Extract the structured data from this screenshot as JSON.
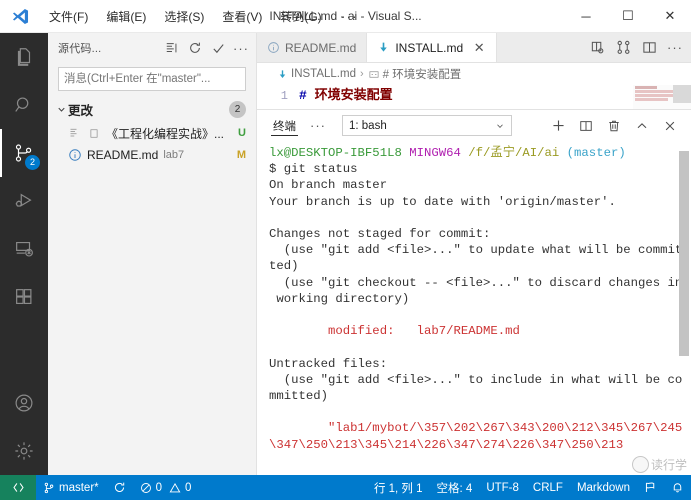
{
  "titlebar": {
    "logo_icon": "vscode-logo-icon",
    "menus": [
      {
        "label": "文件(F)",
        "name": "menu-file"
      },
      {
        "label": "编辑(E)",
        "name": "menu-edit"
      },
      {
        "label": "选择(S)",
        "name": "menu-selection"
      },
      {
        "label": "查看(V)",
        "name": "menu-view"
      },
      {
        "label": "转到(G)",
        "name": "menu-go"
      }
    ],
    "more_label": "···",
    "window_title": "INSTALL.md - ai - Visual S...",
    "minimize_label": "─",
    "maximize_label": "☐",
    "close_label": "✕"
  },
  "activitybar": {
    "items": [
      {
        "name": "explorer",
        "icon": "files-icon",
        "active": false,
        "badge": ""
      },
      {
        "name": "search",
        "icon": "search-icon",
        "active": false,
        "badge": ""
      },
      {
        "name": "source-control",
        "icon": "source-control-icon",
        "active": true,
        "badge": "2"
      },
      {
        "name": "run-and-debug",
        "icon": "debug-icon",
        "active": false,
        "badge": ""
      },
      {
        "name": "remote-explorer",
        "icon": "remote-icon",
        "active": false,
        "badge": ""
      },
      {
        "name": "extensions",
        "icon": "extensions-icon",
        "active": false,
        "badge": ""
      }
    ],
    "bottom_items": [
      {
        "name": "accounts",
        "icon": "account-icon"
      },
      {
        "name": "settings",
        "icon": "gear-icon"
      }
    ]
  },
  "sidebar": {
    "title": "源代码...",
    "actions": [
      {
        "name": "view-as-tree",
        "icon": "list-icon",
        "label": "☰"
      },
      {
        "name": "refresh",
        "icon": "refresh-icon",
        "label": "↻"
      },
      {
        "name": "commit",
        "icon": "check-icon",
        "label": "✓"
      },
      {
        "name": "more-actions",
        "icon": "ellipsis-icon",
        "label": "···"
      }
    ],
    "commit_placeholder": "消息(Ctrl+Enter 在\"master\"...",
    "commit_value": "",
    "group": {
      "label": "更改",
      "count": "2",
      "expanded": true
    },
    "files": [
      {
        "name": "《工程化编程实战》...",
        "path": "",
        "flag": "U",
        "flag_class": "flag-U",
        "icon": "file-lines-icon"
      },
      {
        "name": "README.md",
        "path": "lab7",
        "flag": "M",
        "flag_class": "flag-M",
        "icon": "info-icon"
      }
    ]
  },
  "editor": {
    "tabs": [
      {
        "label": "README.md",
        "icon": "info-icon",
        "active": false,
        "close": ""
      },
      {
        "label": "INSTALL.md",
        "icon": "markdown-down-icon",
        "active": true,
        "close": "✕"
      }
    ],
    "actions": [
      {
        "name": "split-editor-right",
        "icon": "open-changes-icon"
      },
      {
        "name": "compare-changes",
        "icon": "compare-icon"
      },
      {
        "name": "split-editor",
        "icon": "split-editor-icon"
      },
      {
        "name": "more-actions",
        "icon": "ellipsis-icon",
        "label": "···"
      }
    ],
    "breadcrumb": {
      "file": "INSTALL.md",
      "separator": "›",
      "symbol": "# 环境安装配置"
    },
    "lines": [
      {
        "number": "1",
        "hash": "#",
        "text": " 环境安装配置"
      }
    ]
  },
  "panel": {
    "tab_label": "终端",
    "more_label": "···",
    "terminal_select": "1: bash",
    "actions": [
      {
        "name": "new-terminal",
        "icon": "plus-icon",
        "label": "+"
      },
      {
        "name": "split-terminal",
        "icon": "split-icon",
        "label": ""
      },
      {
        "name": "kill-terminal",
        "icon": "trash-icon",
        "label": ""
      },
      {
        "name": "maximize-panel",
        "icon": "chevron-up-icon",
        "label": "⌃"
      },
      {
        "name": "close-panel",
        "icon": "close-icon",
        "label": "✕"
      }
    ],
    "terminal_lines": [
      {
        "segments": [
          {
            "text": "lx@DESKTOP-IBF51L8",
            "cls": "t-green"
          },
          {
            "text": " ",
            "cls": ""
          },
          {
            "text": "MINGW64",
            "cls": "t-purple"
          },
          {
            "text": " ",
            "cls": ""
          },
          {
            "text": "/f/孟宁/AI/ai",
            "cls": "t-olive"
          },
          {
            "text": " ",
            "cls": ""
          },
          {
            "text": "(master)",
            "cls": "t-cyan"
          }
        ]
      },
      {
        "segments": [
          {
            "text": "$ git status",
            "cls": ""
          }
        ]
      },
      {
        "segments": [
          {
            "text": "On branch master",
            "cls": ""
          }
        ]
      },
      {
        "segments": [
          {
            "text": "Your branch is up to date with 'origin/master'.",
            "cls": ""
          }
        ]
      },
      {
        "segments": [
          {
            "text": "",
            "cls": ""
          }
        ]
      },
      {
        "segments": [
          {
            "text": "Changes not staged for commit:",
            "cls": ""
          }
        ]
      },
      {
        "segments": [
          {
            "text": "  (use \"git add <file>...\" to update what will be commit",
            "cls": ""
          }
        ]
      },
      {
        "segments": [
          {
            "text": "ted)",
            "cls": ""
          }
        ]
      },
      {
        "segments": [
          {
            "text": "  (use \"git checkout -- <file>...\" to discard changes in",
            "cls": ""
          }
        ]
      },
      {
        "segments": [
          {
            "text": " working directory)",
            "cls": ""
          }
        ]
      },
      {
        "segments": [
          {
            "text": "",
            "cls": ""
          }
        ]
      },
      {
        "segments": [
          {
            "text": "        modified:   lab7/README.md",
            "cls": "t-red"
          }
        ]
      },
      {
        "segments": [
          {
            "text": "",
            "cls": ""
          }
        ]
      },
      {
        "segments": [
          {
            "text": "Untracked files:",
            "cls": ""
          }
        ]
      },
      {
        "segments": [
          {
            "text": "  (use \"git add <file>...\" to include in what will be co",
            "cls": ""
          }
        ]
      },
      {
        "segments": [
          {
            "text": "mmitted)",
            "cls": ""
          }
        ]
      },
      {
        "segments": [
          {
            "text": "",
            "cls": ""
          }
        ]
      },
      {
        "segments": [
          {
            "text": "        \"lab1/mybot/\\357\\202\\267\\343\\200\\212\\345\\267\\245",
            "cls": "t-red"
          }
        ]
      },
      {
        "segments": [
          {
            "text": "\\347\\250\\213\\345\\214\\226\\347\\274\\226\\347\\250\\213",
            "cls": "t-red"
          }
        ]
      }
    ],
    "watermark": "读行学"
  },
  "statusbar": {
    "remote_icon": "remote-indicator-icon",
    "branch_icon": "git-branch-icon",
    "branch": "master*",
    "sync_icon": "sync-icon",
    "errors_icon": "error-icon",
    "errors": "0",
    "warnings_icon": "warning-icon",
    "warnings": "0",
    "position": "行 1, 列 1",
    "indent": "空格: 4",
    "encoding": "UTF-8",
    "eol": "CRLF",
    "language": "Markdown",
    "feedback_icon": "feedback-icon",
    "bell_icon": "bell-icon"
  },
  "colors": {
    "accent": "#007acc",
    "remote_green": "#16825d",
    "activitybar_bg": "#2c2c2c",
    "sidebar_bg": "#f3f3f3"
  }
}
